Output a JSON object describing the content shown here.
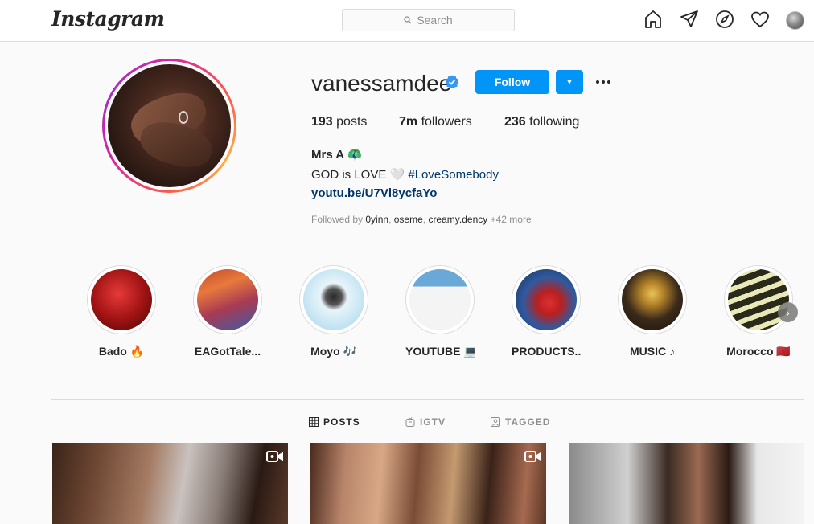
{
  "header": {
    "logo": "Instagram",
    "search_placeholder": "Search"
  },
  "profile": {
    "username": "vanessamdee",
    "verified": true,
    "follow_label": "Follow",
    "stats": {
      "posts_num": "193",
      "posts_label": " posts",
      "followers_num": "7m",
      "followers_label": " followers",
      "following_num": "236",
      "following_label": " following"
    },
    "bio_name": "Mrs A 🦚",
    "bio_text": "GOD is LOVE 🤍 ",
    "bio_hashtag": "#LoveSomebody",
    "bio_link": "youtu.be/U7Vl8ycfaYo",
    "followed_by_prefix": "Followed by ",
    "followed_by_users": [
      "0yinn",
      "oseme",
      "creamy.dency"
    ],
    "followed_by_sep1": ", ",
    "followed_by_sep2": ", ",
    "followed_by_more": " +42 more"
  },
  "highlights": [
    {
      "label": "Bado 🔥"
    },
    {
      "label": "EAGotTale..."
    },
    {
      "label": "Moyo 🎶"
    },
    {
      "label": "YOUTUBE 💻"
    },
    {
      "label": "PRODUCTS..."
    },
    {
      "label": "MUSIC ♪"
    },
    {
      "label": "Morocco 🇲🇦"
    }
  ],
  "tabs": {
    "posts": "POSTS",
    "igtv": "IGTV",
    "tagged": "TAGGED",
    "active": "posts"
  },
  "colors": {
    "accent": "#0095f6",
    "link": "#00376b",
    "border": "#dbdbdb"
  },
  "icons": [
    "home-icon",
    "direct-icon",
    "explore-icon",
    "activity-heart-icon",
    "profile-avatar",
    "verified-badge-icon",
    "more-options-icon",
    "grid-icon",
    "igtv-icon",
    "tagged-icon",
    "video-icon",
    "chevron-right-icon"
  ]
}
